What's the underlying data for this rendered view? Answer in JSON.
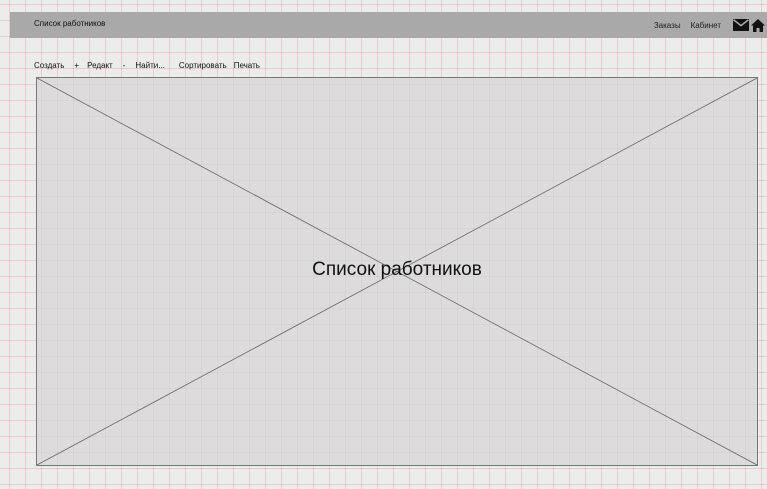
{
  "header": {
    "title": "Список работников",
    "links": [
      "Заказы",
      "Кабинет"
    ],
    "icons": [
      "mail-icon",
      "home-icon"
    ]
  },
  "toolbar": {
    "create_label": "Создать",
    "plus_label": "+",
    "edit_label": "Редакт",
    "minus_label": "-",
    "find_label": "Найти...",
    "sort_label": "Сортировать",
    "print_label": "Печать"
  },
  "main": {
    "placeholder_label": "Список работников"
  },
  "colors": {
    "header_bg": "#a9a9a9",
    "page_bg": "#ececec",
    "grid_line": "#e17878",
    "placeholder_bg": "#d6d6d6"
  }
}
